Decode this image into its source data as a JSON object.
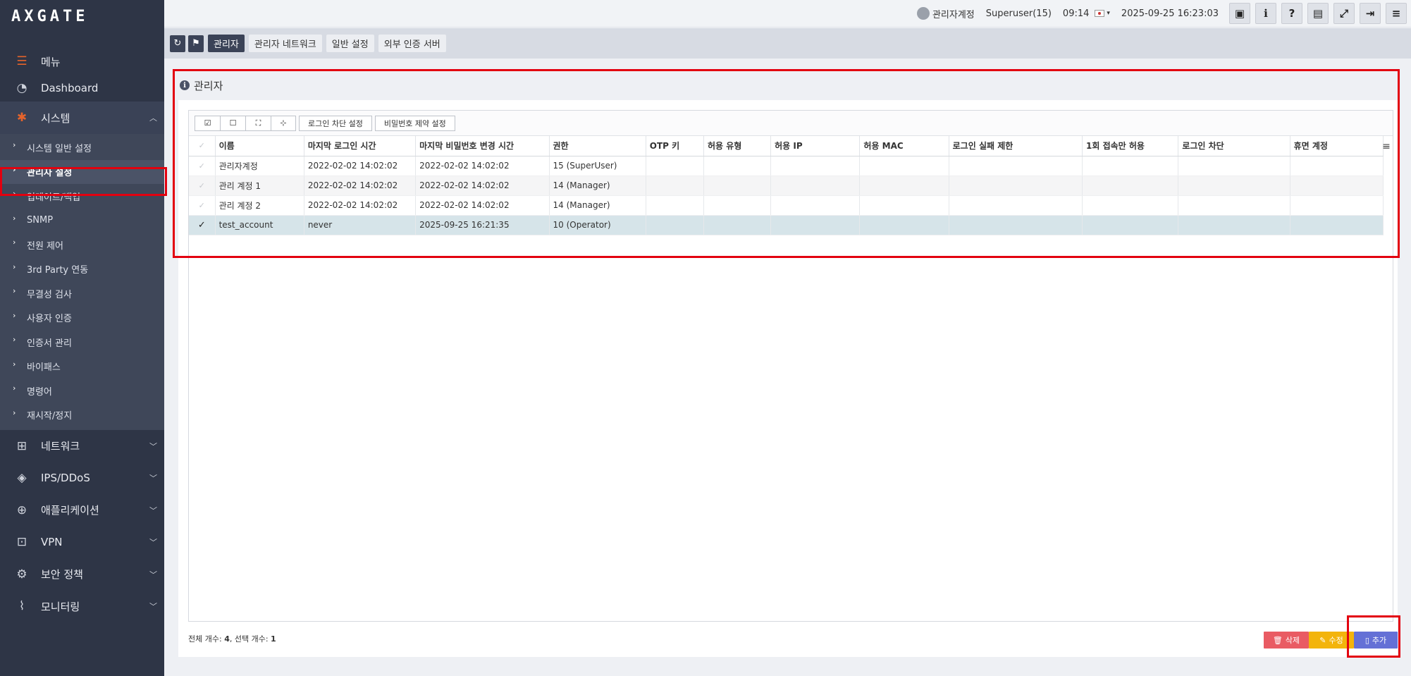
{
  "app": {
    "logo": "AXGATE"
  },
  "sidebar": {
    "menu_label": "메뉴",
    "dashboard": "Dashboard",
    "system": "시스템",
    "system_items": [
      "시스템 일반 설정",
      "관리자 설정",
      "업데이트/백업",
      "SNMP",
      "전원 제어",
      "3rd Party 연동",
      "무결성 검사",
      "사용자 인증",
      "인증서 관리",
      "바이패스",
      "명령어",
      "재시작/정지"
    ],
    "selected_item": "관리자 설정",
    "groups": [
      "네트워크",
      "IPS/DDoS",
      "애플리케이션",
      "VPN",
      "보안 정책",
      "모니터링"
    ]
  },
  "topbar": {
    "user_name": "관리자계정",
    "role": "Superuser(15)",
    "time": "09:14",
    "datetime": "2025-09-25 16:23:03",
    "icons": [
      "save-icon",
      "info-icon",
      "help-icon",
      "list-icon",
      "fullscreen-icon",
      "logout-icon",
      "menu-icon"
    ]
  },
  "tabs": [
    "관리자",
    "관리자 네트워크",
    "일반 설정",
    "외부 인증 서버"
  ],
  "active_tab": "관리자",
  "panel": {
    "title": "관리자"
  },
  "grid": {
    "toolbar": {
      "login_block": "로그인 차단 설정",
      "password_rule": "비밀번호 제약 설정"
    },
    "columns": [
      "이름",
      "마지막 로그인 시간",
      "마지막 비밀번호 변경 시간",
      "권한",
      "OTP 키",
      "허용 유형",
      "허용 IP",
      "허용 MAC",
      "로그인 실패 제한",
      "1회 접속만 허용",
      "로그인 차단",
      "휴면 계정"
    ],
    "rows": [
      {
        "checked": false,
        "name": "관리자계정",
        "last_login": "2022-02-02 14:02:02",
        "last_pw_change": "2022-02-02 14:02:02",
        "permission": "15 (SuperUser)"
      },
      {
        "checked": false,
        "name": "관리 계정 1",
        "last_login": "2022-02-02 14:02:02",
        "last_pw_change": "2022-02-02 14:02:02",
        "permission": "14 (Manager)"
      },
      {
        "checked": false,
        "name": "관리 계정 2",
        "last_login": "2022-02-02 14:02:02",
        "last_pw_change": "2022-02-02 14:02:02",
        "permission": "14 (Manager)"
      },
      {
        "checked": true,
        "name": "test_account",
        "last_login": "never",
        "last_pw_change": "2025-09-25 16:21:35",
        "permission": "10 (Operator)"
      }
    ]
  },
  "footer": {
    "total_label": "전체 개수: ",
    "total": "4",
    "sep": ", ",
    "selected_label": "선택 개수: ",
    "selected": "1"
  },
  "actions": {
    "delete": "삭제",
    "edit": "수정",
    "add": "추가"
  },
  "colors": {
    "sidebar_bg": "#2e3546",
    "accent": "#e5632b",
    "highlight": "#e3000f",
    "delete": "#e95b63",
    "edit": "#f3b40b",
    "add": "#6470d6"
  }
}
